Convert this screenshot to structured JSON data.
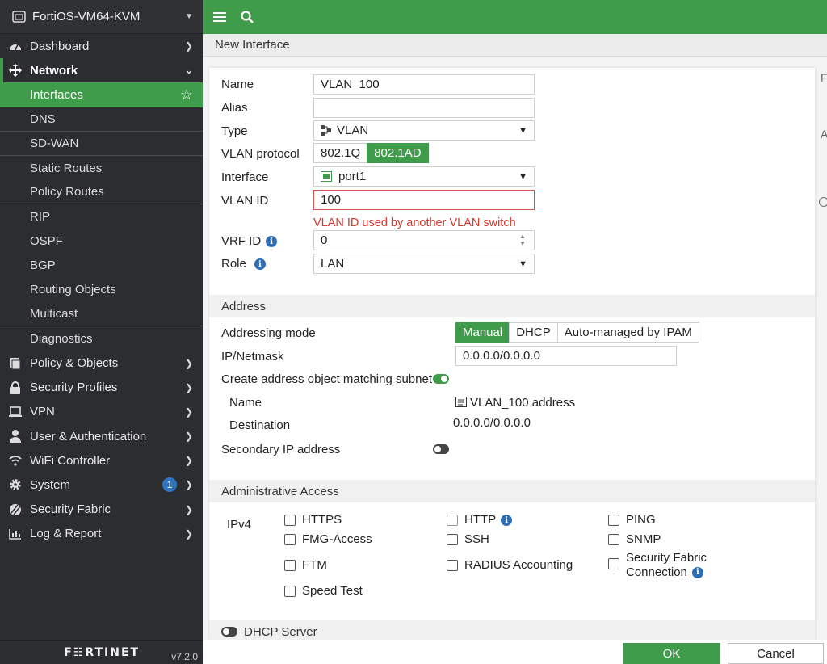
{
  "sidebar": {
    "device_name": "FortiOS-VM64-KVM",
    "items": [
      {
        "label": "Dashboard",
        "icon": "dashboard-icon"
      },
      {
        "label": "Network",
        "icon": "network-icon"
      },
      {
        "label": "Policy & Objects",
        "icon": "policy-icon"
      },
      {
        "label": "Security Profiles",
        "icon": "lock-icon"
      },
      {
        "label": "VPN",
        "icon": "laptop-icon"
      },
      {
        "label": "User & Authentication",
        "icon": "user-icon"
      },
      {
        "label": "WiFi Controller",
        "icon": "wifi-icon"
      },
      {
        "label": "System",
        "icon": "gear-icon",
        "badge": "1"
      },
      {
        "label": "Security Fabric",
        "icon": "fabric-icon"
      },
      {
        "label": "Log & Report",
        "icon": "chart-icon"
      }
    ],
    "network_sub": [
      "Interfaces",
      "DNS",
      "SD-WAN",
      "Static Routes",
      "Policy Routes",
      "RIP",
      "OSPF",
      "BGP",
      "Routing Objects",
      "Multicast",
      "Diagnostics"
    ],
    "logo": "F☷RTINET",
    "version": "v7.2.0"
  },
  "page": {
    "title": "New Interface"
  },
  "form": {
    "name_label": "Name",
    "name_value": "VLAN_100",
    "alias_label": "Alias",
    "alias_value": "",
    "type_label": "Type",
    "type_value": "VLAN",
    "vlan_protocol_label": "VLAN protocol",
    "vlan_protocol_options": [
      "802.1Q",
      "802.1AD"
    ],
    "interface_label": "Interface",
    "interface_value": "port1",
    "vlan_id_label": "VLAN ID",
    "vlan_id_value": "100",
    "vlan_id_error": "VLAN ID used by another VLAN switch",
    "vrf_id_label": "VRF ID",
    "vrf_id_value": "0",
    "role_label": "Role",
    "role_value": "LAN"
  },
  "address": {
    "heading": "Address",
    "mode_label": "Addressing mode",
    "mode_options": [
      "Manual",
      "DHCP",
      "Auto-managed by IPAM"
    ],
    "ip_label": "IP/Netmask",
    "ip_value": "0.0.0.0/0.0.0.0",
    "create_obj_label": "Create address object matching subnet",
    "obj_name_label": "Name",
    "obj_name_value": "VLAN_100 address",
    "destination_label": "Destination",
    "destination_value": "0.0.0.0/0.0.0.0",
    "secondary_label": "Secondary IP address"
  },
  "admin_access": {
    "heading": "Administrative Access",
    "ipv4_label": "IPv4",
    "options": [
      "HTTPS",
      "HTTP",
      "PING",
      "FMG-Access",
      "SSH",
      "SNMP",
      "FTM",
      "RADIUS Accounting",
      "Security Fabric",
      "Connection",
      "Speed Test"
    ]
  },
  "dhcp": {
    "label": "DHCP Server"
  },
  "buttons": {
    "ok": "OK",
    "cancel": "Cancel"
  },
  "side_letters": [
    "F",
    "A"
  ],
  "colors": {
    "accent": "#3f9c4a",
    "sidebar": "#2b2d30",
    "error": "#d9372c",
    "info": "#2f6db5"
  }
}
